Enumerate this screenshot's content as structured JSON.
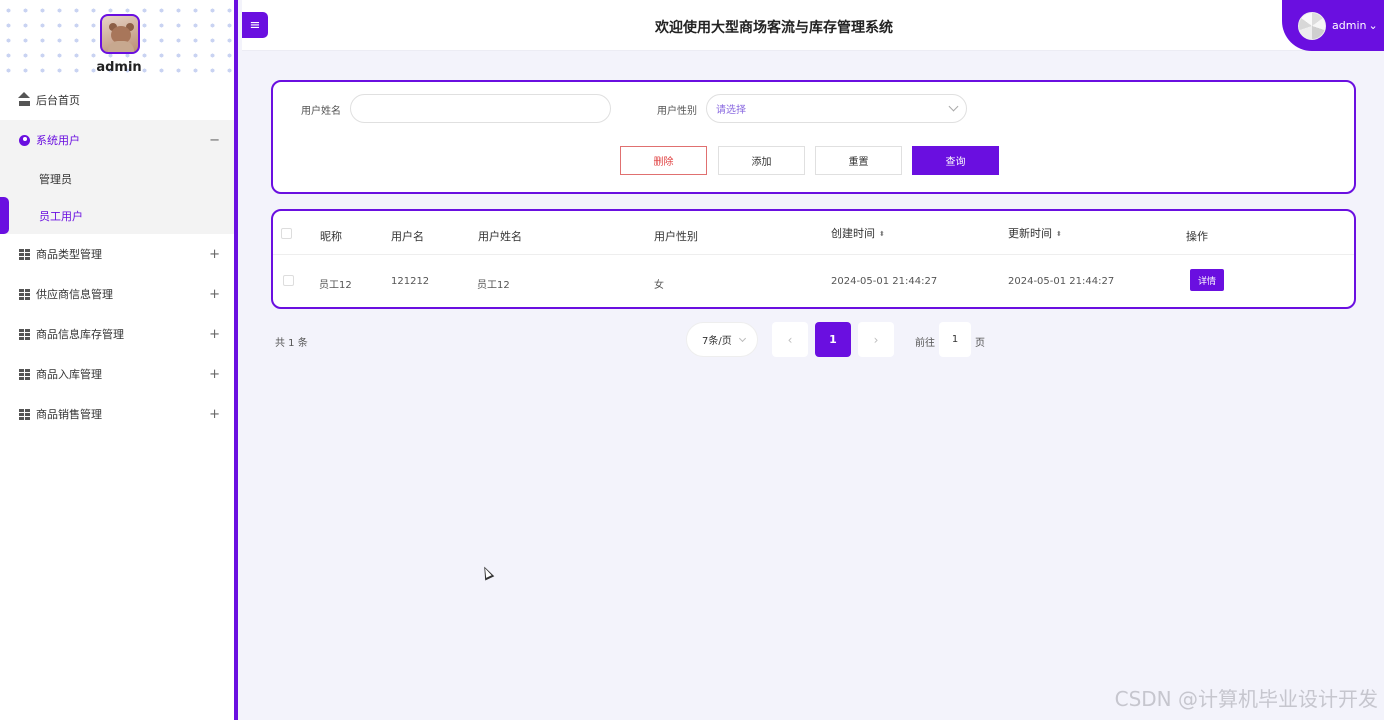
{
  "header": {
    "title": "欢迎使用大型商场客流与库存管理系统",
    "menu_toggle": "≡",
    "user": "admin",
    "user_caret": "⌄"
  },
  "sidebar": {
    "admin_name": "admin",
    "items": [
      {
        "label": "后台首页",
        "icon": "home-icon"
      },
      {
        "label": "系统用户",
        "icon": "user-icon",
        "toggle": "−",
        "children": [
          {
            "label": "管理员"
          },
          {
            "label": "员工用户"
          }
        ]
      },
      {
        "label": "商品类型管理",
        "icon": "grid-icon",
        "toggle": "+"
      },
      {
        "label": "供应商信息管理",
        "icon": "grid-icon",
        "toggle": "+"
      },
      {
        "label": "商品信息库存管理",
        "icon": "grid-icon",
        "toggle": "+"
      },
      {
        "label": "商品入库管理",
        "icon": "grid-icon",
        "toggle": "+"
      },
      {
        "label": "商品销售管理",
        "icon": "grid-icon",
        "toggle": "+"
      }
    ]
  },
  "search": {
    "name_label": "用户姓名",
    "name_value": "",
    "gender_label": "用户性别",
    "gender_placeholder": "请选择",
    "buttons": {
      "delete": "删除",
      "add": "添加",
      "reset": "重置",
      "query": "查询"
    }
  },
  "table": {
    "columns": [
      "昵称",
      "用户名",
      "用户姓名",
      "用户性别",
      "创建时间",
      "更新时间",
      "操作"
    ],
    "sort_glyph": "⬍",
    "rows": [
      {
        "nickname": "员工12",
        "username": "121212",
        "realname": "员工12",
        "gender": "女",
        "created": "2024-05-01 21:44:27",
        "updated": "2024-05-01 21:44:27",
        "action": "详情"
      }
    ]
  },
  "pagination": {
    "total": "共 1 条",
    "page_size": "7条/页",
    "prev": "‹",
    "current": "1",
    "next": "›",
    "goto_prefix": "前往",
    "goto_value": "1",
    "goto_suffix": "页"
  },
  "watermark": "CSDN @计算机毕业设计开发",
  "colors": {
    "accent": "#6a0fe0",
    "danger": "#e04040"
  }
}
